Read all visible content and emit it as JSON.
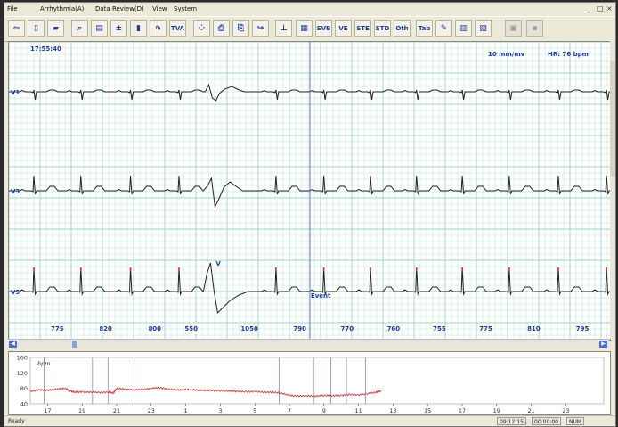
{
  "menu": {
    "items": [
      "File",
      "Arrhythmia(A)",
      "Data Review(D)",
      "View",
      "System"
    ],
    "controls": [
      "_",
      "□",
      "×"
    ]
  },
  "toolbar": {
    "buttons": [
      {
        "name": "back-arrow-icon",
        "glyph": "⇦",
        "enabled": true
      },
      {
        "name": "new-file-icon",
        "glyph": "▯",
        "enabled": true
      },
      {
        "name": "open-folder-icon",
        "glyph": "▰",
        "enabled": true
      },
      {
        "name": "zoom-icon",
        "glyph": "⌕",
        "enabled": true
      },
      {
        "name": "layout-icon",
        "glyph": "▤",
        "enabled": true
      },
      {
        "name": "calipers-icon",
        "glyph": "±",
        "enabled": true
      },
      {
        "name": "bar-chart-icon",
        "glyph": "▮",
        "enabled": true
      },
      {
        "name": "waveform-icon",
        "glyph": "∿",
        "enabled": true
      },
      {
        "name": "tva-button",
        "glyph": "TVA",
        "enabled": true
      },
      {
        "name": "grid-dots-icon",
        "glyph": "⁘",
        "enabled": true
      },
      {
        "name": "print-icon",
        "glyph": "⎙",
        "enabled": true
      },
      {
        "name": "print-preview-icon",
        "glyph": "⎘",
        "enabled": true
      },
      {
        "name": "export-icon",
        "glyph": "↪",
        "enabled": true
      },
      {
        "name": "baseline-icon",
        "glyph": "⊥",
        "enabled": true
      },
      {
        "name": "grid-icon",
        "glyph": "▦",
        "enabled": true
      },
      {
        "name": "svb-button",
        "glyph": "SVB",
        "enabled": true
      },
      {
        "name": "ve-button",
        "glyph": "VE",
        "enabled": true
      },
      {
        "name": "ste-button",
        "glyph": "STE",
        "enabled": true
      },
      {
        "name": "std-button",
        "glyph": "STD",
        "enabled": true
      },
      {
        "name": "oth-button",
        "glyph": "Oth",
        "enabled": true
      },
      {
        "name": "tab-button",
        "glyph": "Tab",
        "enabled": true
      },
      {
        "name": "edit-icon",
        "glyph": "✎",
        "enabled": true
      },
      {
        "name": "report-icon",
        "glyph": "▥",
        "enabled": true
      },
      {
        "name": "chart-icon",
        "glyph": "▧",
        "enabled": true
      },
      {
        "name": "save-icon",
        "glyph": "▣",
        "enabled": false
      },
      {
        "name": "disk-icon",
        "glyph": "▪",
        "enabled": false
      }
    ]
  },
  "ecg": {
    "time": "17:55:40",
    "gain": "10 mm/mv",
    "hr": "HR: 76 bpm",
    "leads": [
      "V1",
      "V3",
      "V5"
    ],
    "beat_label": "V",
    "event_label": "Event",
    "rr_intervals": [
      "775",
      "820",
      "800",
      "550",
      "1050",
      "790",
      "770",
      "760",
      "755",
      "775",
      "810",
      "795"
    ],
    "beat_times_ms": [
      0,
      775,
      1595,
      2395,
      2945,
      3995,
      4785,
      5555,
      6315,
      7070,
      7845,
      8655,
      9450
    ],
    "pvc_index": 4,
    "event_time_ms": 4555,
    "colors": {
      "grid": "#9fd4c5",
      "trace": "#222222",
      "text": "#1a3ea8",
      "marker": "#e03030",
      "cursor": "#5a72c8"
    }
  },
  "trend": {
    "unit": "bpm",
    "y_ticks": [
      "160",
      "120",
      "80",
      "40"
    ],
    "x_ticks": [
      "17",
      "19",
      "21",
      "23",
      "1",
      "3",
      "5",
      "7",
      "9",
      "11",
      "13",
      "15",
      "17",
      "19",
      "21",
      "23"
    ],
    "y_range": [
      40,
      160
    ],
    "series": [
      {
        "h": 16.0,
        "hr": 72
      },
      {
        "h": 16.5,
        "hr": 76
      },
      {
        "h": 17.0,
        "hr": 75
      },
      {
        "h": 17.5,
        "hr": 78
      },
      {
        "h": 18.0,
        "hr": 80
      },
      {
        "h": 18.3,
        "hr": 74
      },
      {
        "h": 18.6,
        "hr": 70
      },
      {
        "h": 19.0,
        "hr": 71
      },
      {
        "h": 19.5,
        "hr": 70
      },
      {
        "h": 20.0,
        "hr": 69
      },
      {
        "h": 20.5,
        "hr": 70
      },
      {
        "h": 20.8,
        "hr": 68
      },
      {
        "h": 21.0,
        "hr": 80
      },
      {
        "h": 21.5,
        "hr": 78
      },
      {
        "h": 22.0,
        "hr": 76
      },
      {
        "h": 22.5,
        "hr": 77
      },
      {
        "h": 23.0,
        "hr": 80
      },
      {
        "h": 23.5,
        "hr": 82
      },
      {
        "h": 24.0,
        "hr": 78
      },
      {
        "h": 24.5,
        "hr": 76
      },
      {
        "h": 25.0,
        "hr": 77
      },
      {
        "h": 25.5,
        "hr": 76
      },
      {
        "h": 26.0,
        "hr": 75
      },
      {
        "h": 26.5,
        "hr": 75
      },
      {
        "h": 27.0,
        "hr": 74
      },
      {
        "h": 27.5,
        "hr": 73
      },
      {
        "h": 28.0,
        "hr": 72
      },
      {
        "h": 28.5,
        "hr": 71
      },
      {
        "h": 29.0,
        "hr": 72
      },
      {
        "h": 29.5,
        "hr": 70
      },
      {
        "h": 30.0,
        "hr": 70
      },
      {
        "h": 30.5,
        "hr": 68
      },
      {
        "h": 31.0,
        "hr": 62
      },
      {
        "h": 31.5,
        "hr": 60
      },
      {
        "h": 32.0,
        "hr": 61
      },
      {
        "h": 32.5,
        "hr": 60
      },
      {
        "h": 33.0,
        "hr": 62
      },
      {
        "h": 33.5,
        "hr": 61
      },
      {
        "h": 34.0,
        "hr": 62
      },
      {
        "h": 34.5,
        "hr": 64
      },
      {
        "h": 35.0,
        "hr": 63
      },
      {
        "h": 35.5,
        "hr": 66
      },
      {
        "h": 36.0,
        "hr": 70
      },
      {
        "h": 36.3,
        "hr": 74
      }
    ],
    "event_hours": [
      16.8,
      19.6,
      20.5,
      22.0,
      30.4,
      32.4,
      33.4,
      34.3,
      35.4
    ],
    "status": [
      "Ready",
      "09:12:15",
      "00:00:00",
      "NUM"
    ]
  }
}
